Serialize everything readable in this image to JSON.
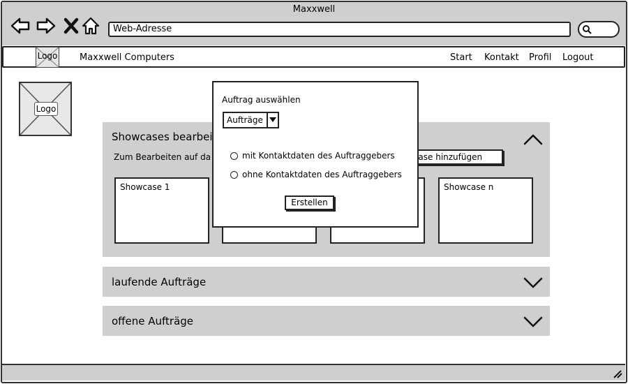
{
  "window": {
    "title": "Maxxwell"
  },
  "browser": {
    "url_placeholder": "Web-Adresse",
    "icons": [
      "back-arrow-icon",
      "forward-arrow-icon",
      "close-icon",
      "home-icon",
      "search-icon"
    ]
  },
  "navbar": {
    "logo": "Logo",
    "brand": "Maxxwell Computers",
    "links": [
      "Start",
      "Kontakt",
      "Profil",
      "Logout"
    ]
  },
  "page": {
    "logo": "Logo"
  },
  "panels": {
    "showcases": {
      "title": "Showcases bearbei",
      "hint": "Zum Bearbeiten auf da",
      "add_button": "wcase hinzufügen",
      "cards": [
        "Showcase 1",
        "",
        "",
        "Showcase n"
      ],
      "chevron": "chevron-up-icon"
    },
    "running": {
      "title": "laufende Aufträge",
      "chevron": "chevron-down-icon"
    },
    "open": {
      "title": "offene Aufträge",
      "chevron": "chevron-down-icon"
    }
  },
  "dialog": {
    "heading": "Auftrag auswählen",
    "select_value": "Aufträge",
    "options": [
      "mit Kontaktdaten des Auftraggebers",
      "ohne Kontaktdaten des Auftraggebers"
    ],
    "create_button": "Erstellen"
  },
  "colors": {
    "panel_bg": "#cfcfcf",
    "stroke": "#222222"
  }
}
